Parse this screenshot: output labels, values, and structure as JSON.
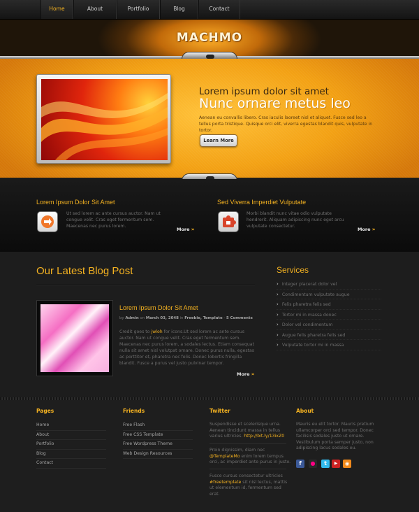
{
  "nav": {
    "items": [
      {
        "label": "Home",
        "active": true
      },
      {
        "label": "About",
        "active": false
      },
      {
        "label": "Portfolio",
        "active": false
      },
      {
        "label": "Blog",
        "active": false
      },
      {
        "label": "Contact",
        "active": false
      }
    ]
  },
  "logo": "MACHMO",
  "hero": {
    "title": "Lorem ipsum dolor sit amet",
    "subtitle": "Nunc ornare metus leo",
    "text": "Aenean eu convallis libero. Cras iaculis laoreet nisl et aliquet. Fusce sed leo a tellus porta tristique. Quisque orci elit, viverra egestas blandit quis, vulputate in tortor.",
    "button": "Learn More"
  },
  "features": [
    {
      "title": "Lorem Ipsum Dolor Sit Amet",
      "text": "Ut sed lorem ac ante cursus auctor. Nam ut congue velit. Cras eget fermentum sem. Maecenas nec purus lorem.",
      "more": "More",
      "icon": "arrow-swap-icon"
    },
    {
      "title": "Sed Viverra Imperdiet Vulputate",
      "text": "Morbi blandit nunc vitae odio vulputate hendrerit. Aliquam adipiscing nunc eget arcu vulputate consectetur.",
      "more": "More",
      "icon": "puzzle-icon"
    }
  ],
  "blog": {
    "heading": "Our Latest Blog Post",
    "post": {
      "title": "Lorem Ipsum Dolor Sit Amet",
      "meta_by": "by",
      "meta_author": "Admin",
      "meta_on": "on",
      "meta_date": "March 03, 2048",
      "meta_in": "in",
      "meta_cats": "Freebie, Template",
      "meta_sep": "-",
      "meta_comments": "5 Comments",
      "body_pre": "Credit goes to ",
      "body_link": "jwloh",
      "body_post": " for icons.Ut sed lorem ac ante cursus auctor. Nam ut congue velit. Cras eget fermentum sem. Maecenas nec purus lorem, a sodales lectus. Etiam consequat nulla sit amet nisl volutpat ornare. Donec purus nulla, egestas ac porttitor et, pharetra nec felis. Donec lobortis fringilla blandit. Fusce a purus vel justo pulvinar tempor.",
      "more": "More"
    }
  },
  "services": {
    "heading": "Services",
    "items": [
      "Integer placerat dolor vel",
      "Condimentum vulputate augue",
      "Felis pharetra felis sed",
      "Tortor mi in massa donec",
      "Dolor vel condimentum",
      "Augue felis pharetra felis sed",
      "Vulputate tortor mi in massa"
    ]
  },
  "footer": {
    "pages": {
      "heading": "Pages",
      "items": [
        "Home",
        "About",
        "Portfolio",
        "Blog",
        "Contact"
      ]
    },
    "friends": {
      "heading": "Friends",
      "items": [
        "Free Flash",
        "Free CSS Template",
        "Free Wordpress Theme",
        "Web Design Resources"
      ]
    },
    "twitter": {
      "heading": "Twitter",
      "t1_pre": "Suspendisse et scelerisque urna. Aenean tincidunt massa in tellus varius ultricies. ",
      "t1_link": "http://bit.ly/13ixZ0",
      "t2_pre": "Proin dignissim, diam nec ",
      "t2_link": "@TemplateMo",
      "t2_post": " enim lorem tempus orci, ac imperdiet ante purus in justo.",
      "t3_pre": "Fusce cursus consectetur ultricies ",
      "t3_link": "#freetemplate",
      "t3_post": " sit nisl lectus, mattis ut elementum id, fermentum sed erat."
    },
    "about": {
      "heading": "About",
      "text": "Mauris eu elit tortor. Mauris pretium ullamcorper orci sed tempor. Donec facilisis sodales justo ut ornare. Vestibulum porta semper justo, non adipiscing lacus sodales eu."
    },
    "social": [
      "facebook-icon",
      "flickr-icon",
      "twitter-icon",
      "youtube-icon",
      "rss-icon"
    ]
  },
  "colors": {
    "accent": "#f4b221",
    "hero": "#f3a114",
    "background": "#1d1d1d"
  }
}
